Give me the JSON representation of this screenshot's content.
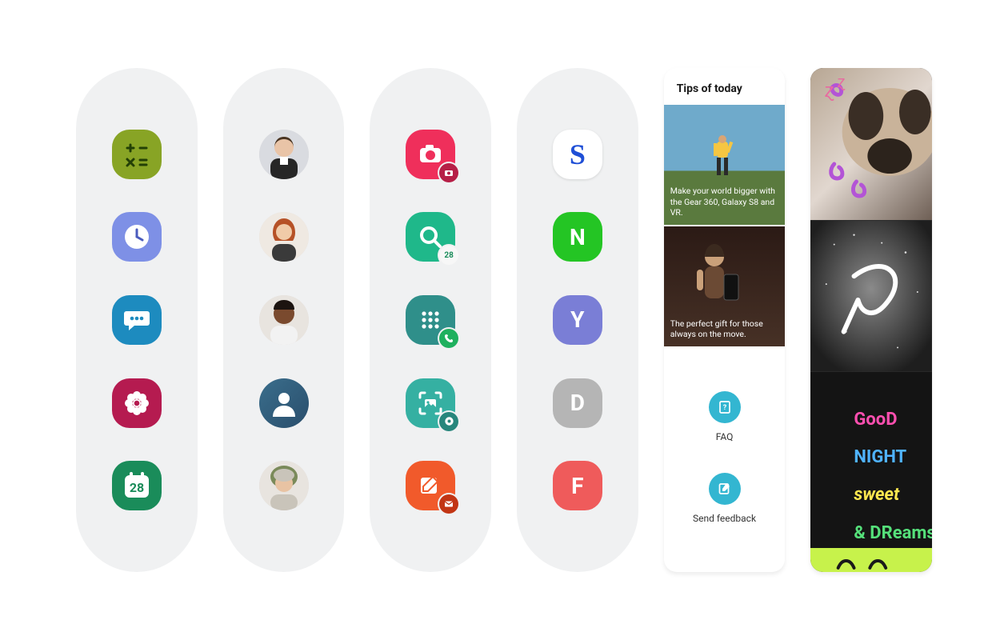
{
  "panels": {
    "apps": [
      {
        "name": "calculator",
        "bg": "#88a425",
        "glyph": "calc"
      },
      {
        "name": "clock",
        "bg": "#7e90e6",
        "glyph": "clock"
      },
      {
        "name": "messages",
        "bg": "#1d8bbf",
        "glyph": "chat"
      },
      {
        "name": "gallery",
        "bg": "#b51b50",
        "glyph": "flower"
      },
      {
        "name": "calendar",
        "bg": "#1a8c5a",
        "glyph": "cal",
        "cal_day": "28"
      }
    ],
    "people": [
      {
        "name": "contact-1",
        "skin": "#e9c4a7",
        "hair": "#4a3523",
        "shirt": "#262626"
      },
      {
        "name": "contact-2",
        "skin": "#f0cba8",
        "hair": "#b24a1e",
        "shirt": "#3a3a3a"
      },
      {
        "name": "contact-3",
        "skin": "#7a4a2e",
        "hair": "#1c1410",
        "shirt": "#f2f2f2"
      },
      {
        "name": "contact-4",
        "skin": "#d9b08c",
        "hair": "#3a5e8c",
        "shirt": "#3a5e8c",
        "circlebg": "#3a6e8c",
        "generic": true
      },
      {
        "name": "contact-5",
        "skin": "#e8c3a3",
        "hair": "#7a8a5a",
        "shirt": "#c9c4ba"
      }
    ],
    "shortcuts": [
      {
        "name": "camera-shortcut",
        "bg": "#ef2f5b",
        "glyph": "camera",
        "badge_bg": "#b61f47",
        "badge_glyph": "camera-mini"
      },
      {
        "name": "finder-shortcut",
        "bg": "#1fb88a",
        "glyph": "search",
        "badge_bg": "#f7f7f7",
        "badge_glyph": "28",
        "badge_text": true
      },
      {
        "name": "keypad-shortcut",
        "bg": "#2f8f8a",
        "glyph": "keypad",
        "badge_bg": "#1fb05e",
        "badge_glyph": "phone"
      },
      {
        "name": "smart-capture-shortcut",
        "bg": "#35b0a2",
        "glyph": "capture",
        "badge_bg": "#27867c",
        "badge_glyph": "gear"
      },
      {
        "name": "compose-shortcut",
        "bg": "#f15a2b",
        "glyph": "compose",
        "badge_bg": "#c23514",
        "badge_glyph": "mail"
      }
    ],
    "letter_apps": [
      {
        "name": "app-s",
        "letter": "S",
        "bg": "#ffffff",
        "fg": "#1f4fd6",
        "font": "script"
      },
      {
        "name": "app-n",
        "letter": "N",
        "bg": "#24c524",
        "fg": "#ffffff"
      },
      {
        "name": "app-y",
        "letter": "Y",
        "bg": "#7a7ed6",
        "fg": "#ffffff"
      },
      {
        "name": "app-d",
        "letter": "D",
        "bg": "#b5b5b5",
        "fg": "#ffffff"
      },
      {
        "name": "app-f",
        "letter": "F",
        "bg": "#ef5b5b",
        "fg": "#ffffff"
      }
    ]
  },
  "tips": {
    "title": "Tips of today",
    "cards": [
      {
        "caption": "Make your world bigger with the Gear 360, Galaxy S8 and VR."
      },
      {
        "caption": "The perfect gift for those always on the move."
      }
    ],
    "actions": {
      "faq": "FAQ",
      "feedback": "Send feedback"
    }
  },
  "gallery": {
    "chalk_lines": [
      "GooD",
      "NIGHT",
      "sweet",
      "& DReams!"
    ]
  }
}
